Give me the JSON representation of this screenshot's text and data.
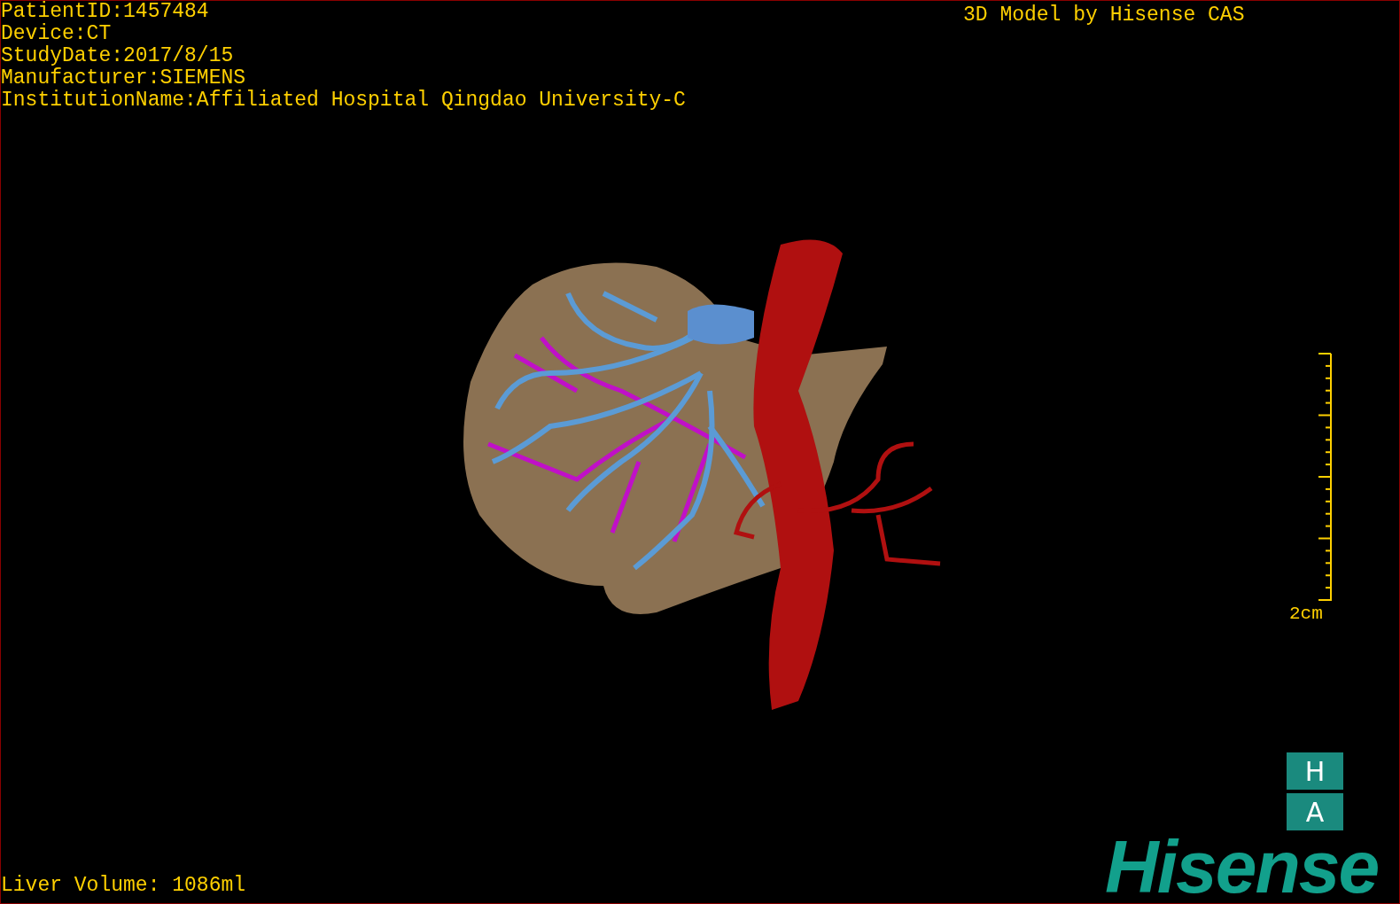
{
  "study_info": [
    "PatientID:1457484",
    "Device:CT",
    "StudyDate:2017/8/15",
    "Manufacturer:SIEMENS",
    "InstitutionName:Affiliated Hospital Qingdao University-C"
  ],
  "model_credit": "3D Model by Hisense CAS",
  "scale_bar": {
    "label": "2cm"
  },
  "orientation_cube": [
    "H",
    "A"
  ],
  "logo": "Hisense",
  "liver_volume": "Liver Volume: 1086ml"
}
